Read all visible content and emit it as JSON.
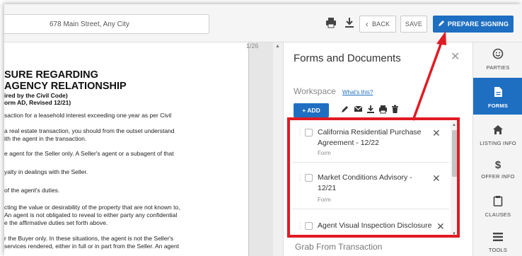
{
  "toolbar": {
    "address": "678 Main Street, Any City",
    "back_label": "BACK",
    "save_label": "SAVE",
    "prepare_label": "PREPARE SIGNING",
    "page_indicator": "1/26"
  },
  "document": {
    "title_lines": [
      "SURE REGARDING",
      "AGENCY RELATIONSHIP"
    ],
    "sub_lines": [
      "ired by the Civil Code)",
      "orm AD, Revised 12/21)"
    ],
    "body_lines": [
      "saction for a leasehold interest exceeding one year as per Civil",
      "a real estate transaction, you should from the outset understand",
      "ith the agent in the transaction.",
      "e agent for the Seller only. A Seller's agent or a subagent of that",
      "yalty in dealings with the Seller.",
      "of the agent's duties.",
      "cting the value or desirability of the property that are not known to,",
      "An agent is not obligated to reveal to either party any confidential",
      "e the affirmative duties set forth above.",
      "r the Buyer only. In these situations, the agent is not the Seller's",
      "services rendered, either in full or in part from the Seller. An agent"
    ]
  },
  "panel": {
    "title": "Forms and Documents",
    "workspace_label": "Workspace",
    "whats_this": "What's this?",
    "add_label": "+ ADD",
    "items": [
      {
        "name": "California Residential Purchase Agreement - 12/22",
        "type": "Form"
      },
      {
        "name": "Market Conditions Advisory - 12/21",
        "type": "Form"
      },
      {
        "name": "Agent Visual Inspection Disclosure",
        "type": ""
      }
    ],
    "grab_label": "Grab From Transaction"
  },
  "rail": {
    "items": [
      {
        "label": "PARTIES",
        "icon": "smiley-icon"
      },
      {
        "label": "FORMS",
        "icon": "file-icon"
      },
      {
        "label": "LISTING INFO",
        "icon": "home-icon"
      },
      {
        "label": "OFFER INFO",
        "icon": "dollar-icon"
      },
      {
        "label": "CLAUSES",
        "icon": "clipboard-icon"
      },
      {
        "label": "TOOLS",
        "icon": "list-icon"
      }
    ]
  },
  "colors": {
    "primary": "#1e6fc1",
    "annotation": "#e01b24"
  }
}
